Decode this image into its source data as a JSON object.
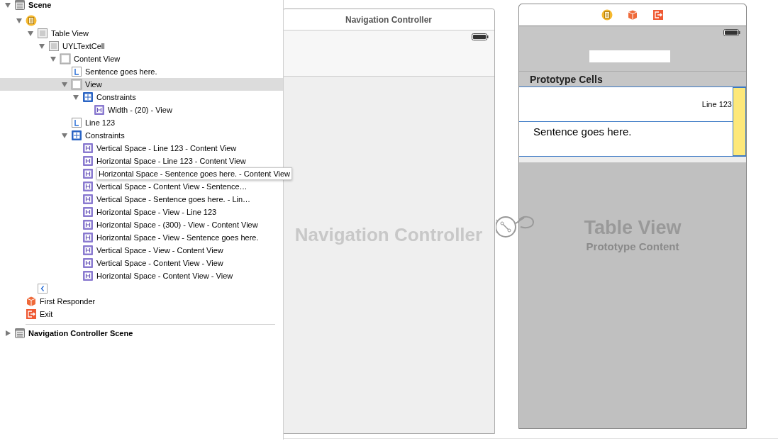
{
  "outline": {
    "items": [
      {
        "kind": "scene",
        "label": "Scene",
        "expanded": true,
        "selected": false,
        "children": [
          {
            "kind": "controller",
            "expanded": true,
            "selected": false,
            "children": [
              {
                "kind": "table",
                "label": "Table View",
                "expanded": true,
                "selected": false,
                "children": [
                  {
                    "kind": "table",
                    "label": "UYLTextCell",
                    "expanded": true,
                    "selected": false,
                    "children": [
                      {
                        "kind": "view",
                        "label": "Content View",
                        "expanded": true,
                        "selected": false,
                        "children": [
                          {
                            "kind": "label",
                            "label": "Sentence goes here.",
                            "selected": false
                          },
                          {
                            "kind": "view",
                            "label": "View",
                            "expanded": true,
                            "selected": true,
                            "children": [
                              {
                                "kind": "constraints",
                                "label": "Constraints",
                                "expanded": true,
                                "selected": false,
                                "children": [
                                  {
                                    "kind": "constraint",
                                    "label": "Width - (20) - View",
                                    "selected": false
                                  }
                                ]
                              }
                            ]
                          },
                          {
                            "kind": "label",
                            "label": "Line 123",
                            "selected": false
                          },
                          {
                            "kind": "constraints",
                            "label": "Constraints",
                            "expanded": true,
                            "selected": false,
                            "children": [
                              {
                                "kind": "constraint",
                                "label": "Vertical Space - Line 123 - Content View",
                                "selected": false,
                                "hovered": false
                              },
                              {
                                "kind": "constraint",
                                "label": "Horizontal Space - Line 123 - Content View",
                                "selected": false,
                                "hovered": false
                              },
                              {
                                "kind": "constraint",
                                "label": "Horizontal Space - Sentence goes here. - Content View",
                                "selected": false,
                                "hovered": true
                              },
                              {
                                "kind": "constraint",
                                "label": "Vertical Space - Content View - Sentence…",
                                "selected": false,
                                "hovered": false
                              },
                              {
                                "kind": "constraint",
                                "label": "Vertical Space - Sentence goes here. - Lin…",
                                "selected": false,
                                "hovered": false
                              },
                              {
                                "kind": "constraint",
                                "label": "Horizontal Space - View - Line 123",
                                "selected": false,
                                "hovered": false
                              },
                              {
                                "kind": "constraint",
                                "label": "Horizontal Space - (300) - View - Content View",
                                "selected": false,
                                "hovered": false
                              },
                              {
                                "kind": "constraint",
                                "label": "Horizontal Space - View - Sentence goes here.",
                                "selected": false,
                                "hovered": false
                              },
                              {
                                "kind": "constraint",
                                "label": "Vertical Space - View - Content View",
                                "selected": false,
                                "hovered": false
                              },
                              {
                                "kind": "constraint",
                                "label": "Vertical Space - Content View - View",
                                "selected": false,
                                "hovered": false
                              },
                              {
                                "kind": "constraint",
                                "label": "Horizontal Space - Content View - View",
                                "selected": false,
                                "hovered": false
                              }
                            ]
                          }
                        ]
                      }
                    ]
                  }
                ]
              },
              {
                "kind": "nav-item",
                "selected": false
              }
            ]
          },
          {
            "kind": "responder",
            "label": "First Responder",
            "selected": false
          },
          {
            "kind": "exit",
            "label": "Exit",
            "selected": false
          }
        ]
      },
      {
        "kind": "scene",
        "label": "Navigation Controller Scene",
        "expanded": false,
        "selected": false
      }
    ]
  },
  "canvas": {
    "nav_scene": {
      "title": "Navigation Controller",
      "watermark": "Navigation Controller"
    },
    "table_scene": {
      "section_header": "Prototype Cells",
      "detail_label": "Line 123",
      "cell_label": "Sentence goes here.",
      "watermark_title": "Table View",
      "watermark_subtitle": "Prototype Content"
    }
  }
}
